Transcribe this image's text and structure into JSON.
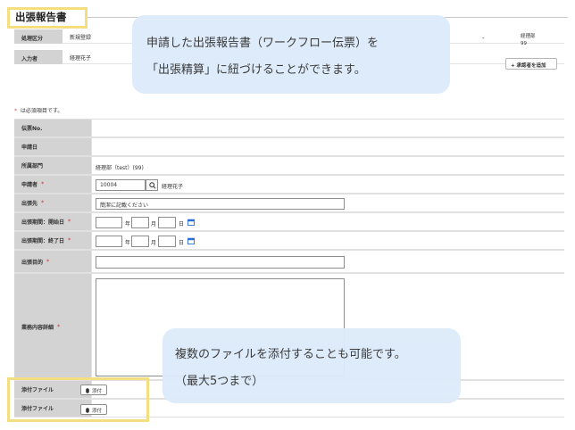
{
  "page": {
    "title": "出張報告書"
  },
  "header": {
    "rows": [
      {
        "label": "処理区分",
        "value": "新規登録"
      },
      {
        "label": "入力者",
        "value": "経理花子"
      }
    ],
    "dash": "-",
    "dept_line1": "経理部",
    "dept_line2": "99",
    "approver_button": "+ 承認者を追加"
  },
  "required_note": {
    "asterisk": "*",
    "text": " は必須項目です。"
  },
  "form": {
    "voucher_no_label": "伝票No.",
    "apply_date_label": "申請日",
    "department_label": "所属部門",
    "department_value": "経理部（test）(99)",
    "applicant_label": "申請者",
    "applicant_code": "10004",
    "applicant_name": "経理花子",
    "destination_label": "出張先",
    "destination_value": "簡潔に記載ください",
    "start_label": "出張期間：開始日",
    "end_label": "出張期間：終了日",
    "year": "年",
    "month": "月",
    "day": "日",
    "purpose_label": "出張目的",
    "details_label": "業務内容詳細",
    "attach_label_1": "添付ファイル",
    "attach_label_2": "添付ファイル",
    "attach_button": "添付",
    "required_mark": "*"
  },
  "callouts": {
    "top_line1": "申請した出張報告書（ワークフロー伝票）を",
    "top_line2": "「出張精算」に紐づけることができます。",
    "bottom_line1": "複数のファイルを添付することも可能です。",
    "bottom_line2": "（最大5つまで）"
  },
  "colors": {
    "highlight": "#f5de82",
    "label_bg": "#d3d3d3",
    "required": "#d9534f",
    "callout_bg": "#ddebfa",
    "calendar_icon": "#2b6cd8"
  }
}
